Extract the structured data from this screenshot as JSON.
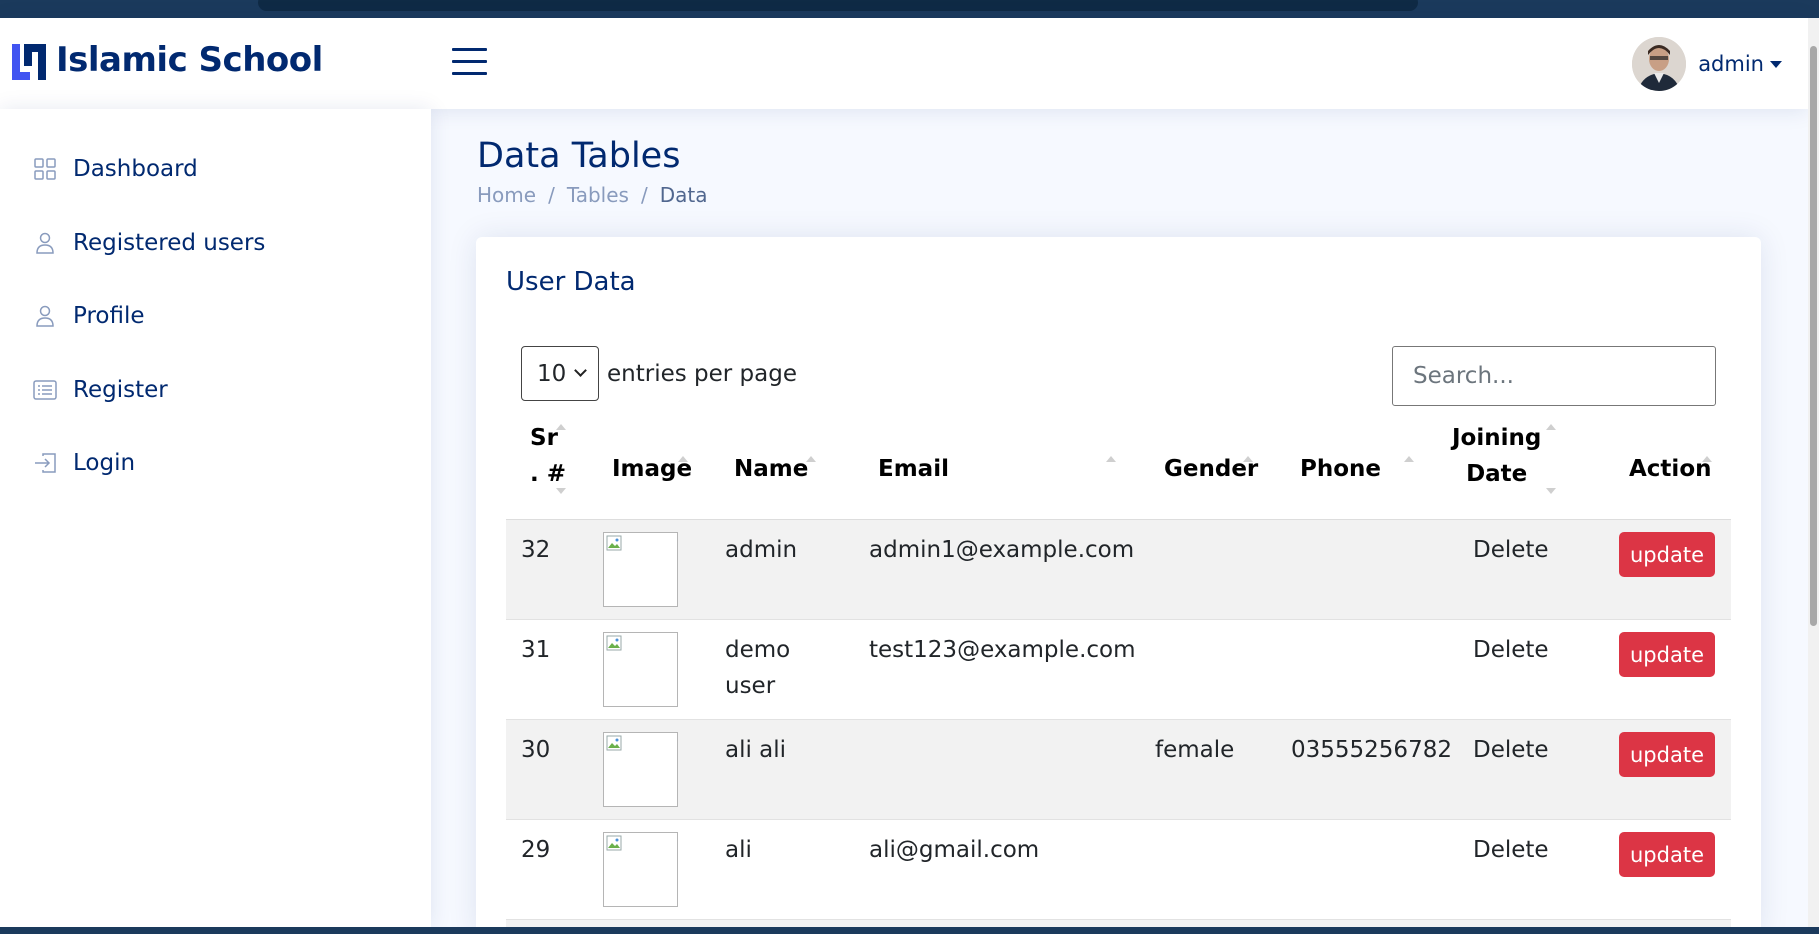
{
  "header": {
    "app_name": "Islamic School",
    "user_name": "admin"
  },
  "sidebar": {
    "items": [
      {
        "label": "Dashboard",
        "icon": "grid-icon"
      },
      {
        "label": "Registered users",
        "icon": "person-icon"
      },
      {
        "label": "Profile",
        "icon": "person-icon"
      },
      {
        "label": "Register",
        "icon": "card-list-icon"
      },
      {
        "label": "Login",
        "icon": "box-arrow-in-right-icon"
      }
    ]
  },
  "page": {
    "title": "Data Tables",
    "breadcrumb": [
      "Home",
      "Tables",
      "Data"
    ]
  },
  "card": {
    "title": "User Data",
    "per_page_value": "10",
    "per_page_label": "entries per page",
    "search_placeholder": "Search..."
  },
  "table": {
    "columns": [
      {
        "line1": "Sr",
        "line2": ". #"
      },
      {
        "line1": "",
        "line2": "Image"
      },
      {
        "line1": "",
        "line2": "Name"
      },
      {
        "line1": "",
        "line2": "Email"
      },
      {
        "line1": "",
        "line2": "Gender"
      },
      {
        "line1": "",
        "line2": "Phone"
      },
      {
        "line1": "Joining",
        "line2": "Date"
      },
      {
        "line1": "",
        "line2": "Action"
      }
    ],
    "rows": [
      {
        "sr": "32",
        "name_line1": "admin",
        "name_line2": "",
        "email": "admin1@example.com",
        "gender": "",
        "phone": "",
        "joining": "Delete",
        "action": "update"
      },
      {
        "sr": "31",
        "name_line1": "demo",
        "name_line2": "user",
        "email": "test123@example.com",
        "gender": "",
        "phone": "",
        "joining": "Delete",
        "action": "update"
      },
      {
        "sr": "30",
        "name_line1": "ali ali",
        "name_line2": "",
        "email": "",
        "gender": "female",
        "phone": "03555256782",
        "joining": "Delete",
        "action": "update"
      },
      {
        "sr": "29",
        "name_line1": "ali",
        "name_line2": "",
        "email": "ali@gmail.com",
        "gender": "",
        "phone": "",
        "joining": "Delete",
        "action": "update"
      }
    ]
  },
  "colors": {
    "primary_text": "#012970",
    "update_button": "#dc3545",
    "logo_accent": "#4154f1"
  }
}
